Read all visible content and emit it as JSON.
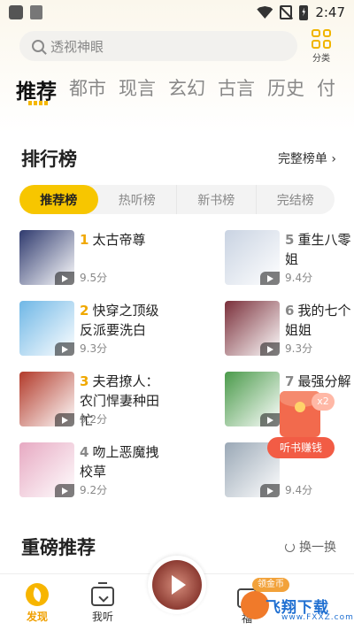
{
  "status_bar": {
    "time": "2:47"
  },
  "search": {
    "placeholder": "透视神眼"
  },
  "category_button": {
    "label": "分类"
  },
  "tabs": [
    {
      "label": "推荐"
    },
    {
      "label": "都市"
    },
    {
      "label": "现言"
    },
    {
      "label": "玄幻"
    },
    {
      "label": "古言"
    },
    {
      "label": "历史"
    },
    {
      "label": "付"
    }
  ],
  "ranking": {
    "title": "排行榜",
    "full_list_label": "完整榜单 ›",
    "rank_tabs": [
      {
        "label": "推荐榜"
      },
      {
        "label": "热听榜"
      },
      {
        "label": "新书榜"
      },
      {
        "label": "完结榜"
      }
    ],
    "books": [
      {
        "rank": "1",
        "title": "太古帝尊",
        "score": "9.5分",
        "cover_color": "#2f3a6e"
      },
      {
        "rank": "2",
        "title": "快穿之顶级反派要洗白",
        "score": "9.3分",
        "cover_color": "#6fb7e6"
      },
      {
        "rank": "3",
        "title": "夫君撩人：农门悍妻种田忙",
        "score": "9.2分",
        "cover_color": "#b23a2a"
      },
      {
        "rank": "4",
        "title": "吻上恶魔拽校草",
        "score": "9.2分",
        "cover_color": "#e7a9c2"
      },
      {
        "rank": "5",
        "title": "重生八零姐",
        "score": "9.4分",
        "cover_color": "#c9d3e2"
      },
      {
        "rank": "6",
        "title": "我的七个姐姐",
        "score": "9.3分",
        "cover_color": "#7a2f3a"
      },
      {
        "rank": "7",
        "title": "最强分解",
        "score": "",
        "cover_color": "#4a9a4a"
      },
      {
        "rank": "",
        "title": "",
        "score": "9.4分",
        "cover_color": "#9aa8b6"
      }
    ]
  },
  "promo": {
    "badge": "x2",
    "label": "听书赚钱"
  },
  "featured": {
    "title": "重磅推荐",
    "refresh_label": "换一换"
  },
  "bottom_nav": {
    "discover": "发现",
    "listen": "我听",
    "welfare": "福",
    "coin_badge": "领金币"
  },
  "watermark": {
    "text": "飞翔下载",
    "sub": "www.FXXZ.com"
  }
}
